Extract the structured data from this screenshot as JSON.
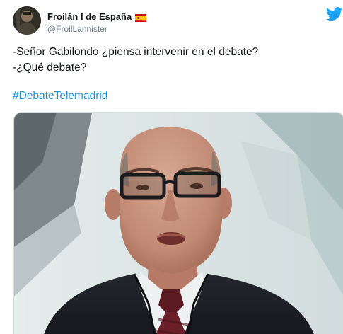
{
  "tweet": {
    "display_name": "Froilán I de España",
    "handle": "@FroilLannister",
    "lines": [
      "-Señor Gabilondo ¿piensa intervenir en el debate?",
      "-¿Qué debate?"
    ],
    "hashtag": "#DebateTelemadrid"
  },
  "icons": {
    "brand": "twitter-bird-icon",
    "flag": "spain-flag-icon"
  },
  "colors": {
    "brand": "#1da1f2",
    "link": "#1b95e0",
    "text": "#14171a",
    "secondary_text": "#657786"
  }
}
